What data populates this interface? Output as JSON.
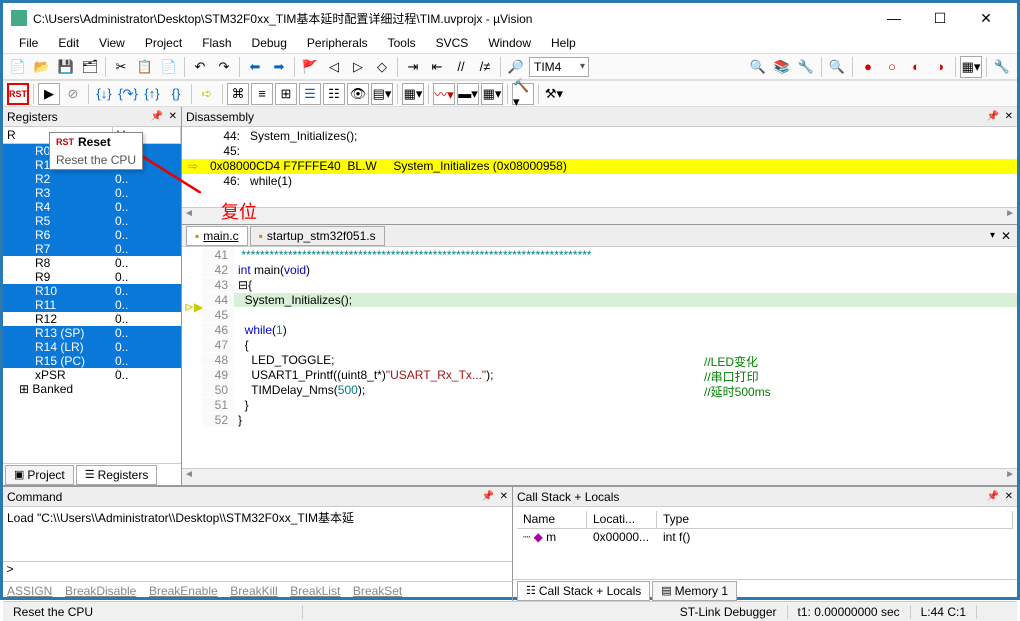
{
  "title": "C:\\Users\\Administrator\\Desktop\\STM32F0xx_TIM基本延时配置详细过程\\TIM.uvprojx - µVision",
  "menu": [
    "File",
    "Edit",
    "View",
    "Project",
    "Flash",
    "Debug",
    "Peripherals",
    "Tools",
    "SVCS",
    "Window",
    "Help"
  ],
  "combo_tim": "TIM4",
  "tooltip": {
    "title": "Reset",
    "desc": "Reset the CPU"
  },
  "overlay_text": "复位",
  "registers": {
    "panel_title": "Registers",
    "col1": "R",
    "col2": "V..",
    "rows": [
      {
        "n": "R0",
        "v": "0..",
        "sel": true
      },
      {
        "n": "R1",
        "v": "0..",
        "sel": true
      },
      {
        "n": "R2",
        "v": "0..",
        "sel": true
      },
      {
        "n": "R3",
        "v": "0..",
        "sel": true
      },
      {
        "n": "R4",
        "v": "0..",
        "sel": true
      },
      {
        "n": "R5",
        "v": "0..",
        "sel": true
      },
      {
        "n": "R6",
        "v": "0..",
        "sel": true
      },
      {
        "n": "R7",
        "v": "0..",
        "sel": true
      },
      {
        "n": "R8",
        "v": "0..",
        "sel": false
      },
      {
        "n": "R9",
        "v": "0..",
        "sel": false
      },
      {
        "n": "R10",
        "v": "0..",
        "sel": true
      },
      {
        "n": "R11",
        "v": "0..",
        "sel": true
      },
      {
        "n": "R12",
        "v": "0..",
        "sel": false
      },
      {
        "n": "R13 (SP)",
        "v": "0..",
        "sel": true
      },
      {
        "n": "R14 (LR)",
        "v": "0..",
        "sel": true
      },
      {
        "n": "R15 (PC)",
        "v": "0..",
        "sel": true
      },
      {
        "n": "xPSR",
        "v": "0..",
        "sel": false
      },
      {
        "n": "Banked",
        "v": "",
        "sel": false
      }
    ],
    "tab_project": "Project",
    "tab_registers": "Registers"
  },
  "disasm": {
    "title": "Disassembly",
    "lines": [
      {
        "n": "44",
        "txt": "    44:   System_Initializes();"
      },
      {
        "n": "45",
        "txt": "    45: "
      },
      {
        "n": "",
        "txt": "0x08000CD4 F7FFFE40  BL.W     System_Initializes (0x08000958)",
        "hl": true,
        "arrow": true
      },
      {
        "n": "46",
        "txt": "    46:   while(1)"
      }
    ]
  },
  "tabs": {
    "main": "main.c",
    "startup": "startup_stm32f051.s"
  },
  "code": [
    {
      "n": 41,
      "txt": " ****************************************************************************"
    },
    {
      "n": 42,
      "txt": "int main(void)"
    },
    {
      "n": 43,
      "txt": "{",
      "brace": "open"
    },
    {
      "n": 44,
      "txt": "  System_Initializes();",
      "cur": true
    },
    {
      "n": 45,
      "txt": ""
    },
    {
      "n": 46,
      "txt": "  while(1)"
    },
    {
      "n": 47,
      "txt": "  {"
    },
    {
      "n": 48,
      "txt": "    LED_TOGGLE;",
      "cmt": "//LED变化"
    },
    {
      "n": 49,
      "txt": "    USART1_Printf((uint8_t*)\"USART_Rx_Tx...\");",
      "cmt": "//串口打印"
    },
    {
      "n": 50,
      "txt": "    TIMDelay_Nms(500);",
      "cmt": "//延时500ms"
    },
    {
      "n": 51,
      "txt": "  }"
    },
    {
      "n": 52,
      "txt": "}"
    }
  ],
  "command": {
    "title": "Command",
    "body": "Load \"C:\\\\Users\\\\Administrator\\\\Desktop\\\\STM32F0xx_TIM基本延",
    "prompt": ">",
    "btns": [
      "ASSIGN",
      "BreakDisable",
      "BreakEnable",
      "BreakKill",
      "BreakList",
      "BreakSet"
    ]
  },
  "callstack": {
    "title": "Call Stack + Locals",
    "cols": [
      "Name",
      "Locati...",
      "Type"
    ],
    "row": {
      "name": "m",
      "loc": "0x00000...",
      "type": "int f()"
    },
    "tab1": "Call Stack + Locals",
    "tab2": "Memory 1"
  },
  "status": {
    "reset": "Reset the CPU",
    "dbg": "ST-Link Debugger",
    "t1": "t1: 0.00000000 sec",
    "lc": "L:44 C:1"
  }
}
